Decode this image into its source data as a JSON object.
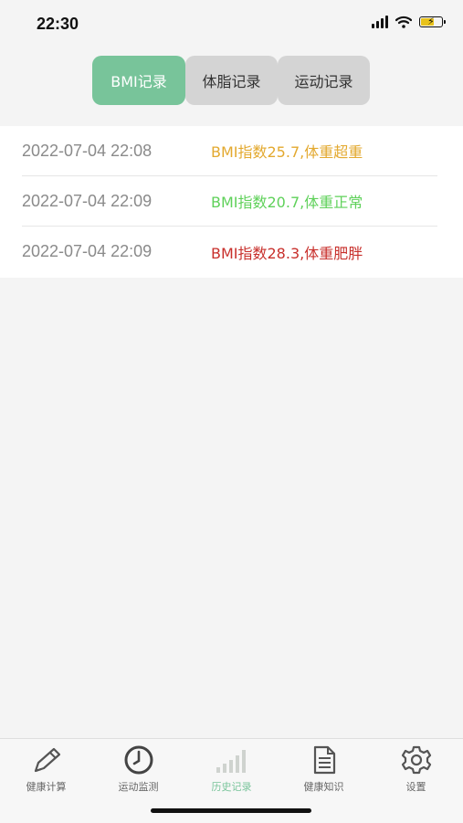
{
  "status_bar": {
    "time": "22:30"
  },
  "segments": [
    {
      "label": "BMI记录",
      "active": true
    },
    {
      "label": "体脂记录",
      "active": false
    },
    {
      "label": "运动记录",
      "active": false
    }
  ],
  "records": [
    {
      "date": "2022-07-04 22:08",
      "text": "BMI指数25.7,体重超重",
      "color": "#e3a92f"
    },
    {
      "date": "2022-07-04 22:09",
      "text": "BMI指数20.7,体重正常",
      "color": "#5fd15a"
    },
    {
      "date": "2022-07-04 22:09",
      "text": "BMI指数28.3,体重肥胖",
      "color": "#c8302c"
    }
  ],
  "tabbar": [
    {
      "label": "健康计算",
      "icon": "pencil-icon",
      "active": false
    },
    {
      "label": "运动监测",
      "icon": "clock-icon",
      "active": false
    },
    {
      "label": "历史记录",
      "icon": "bar-chart-icon",
      "active": true
    },
    {
      "label": "健康知识",
      "icon": "document-icon",
      "active": false
    },
    {
      "label": "设置",
      "icon": "gear-icon",
      "active": false
    }
  ],
  "colors": {
    "accent": "#78c49a",
    "inactive_segment": "#d4d4d4"
  }
}
